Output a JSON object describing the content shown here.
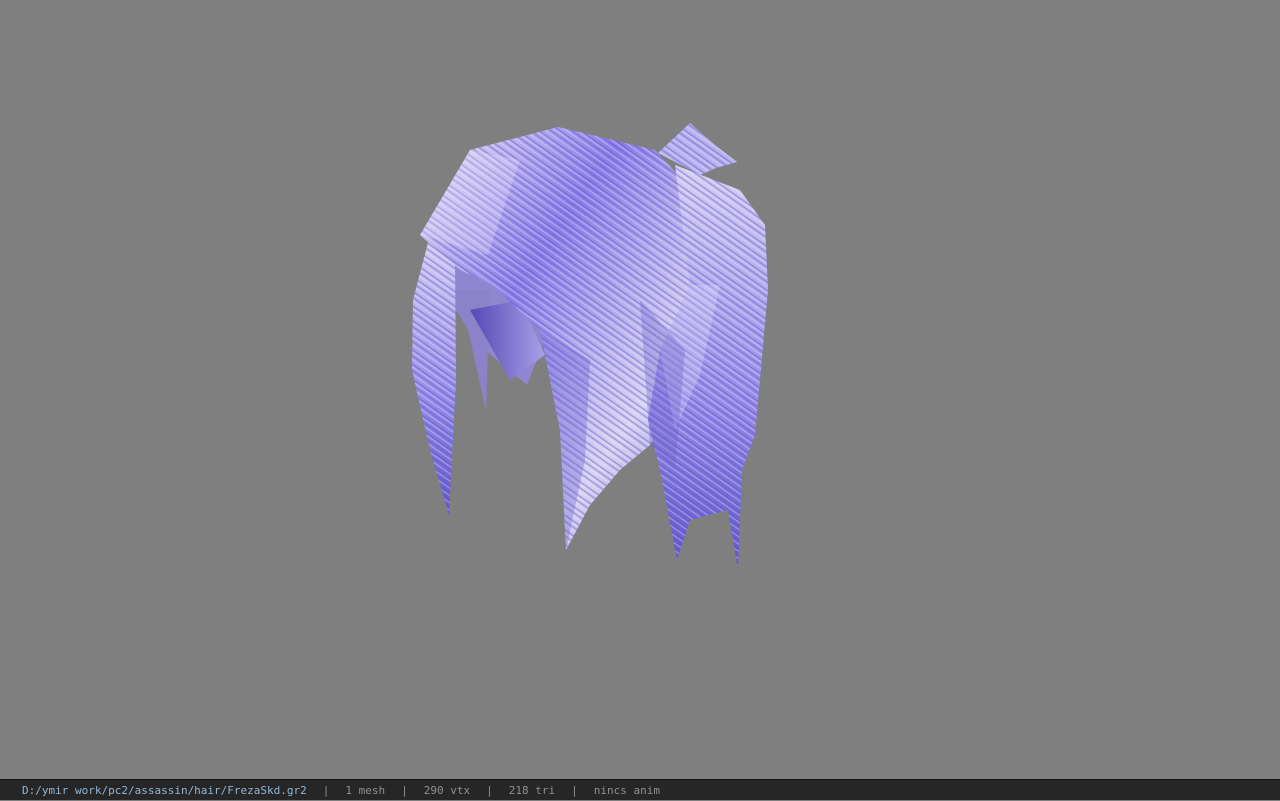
{
  "viewer": {
    "background_color": "#7f7f7f",
    "model_name": "hair-mesh"
  },
  "status_bar": {
    "file_path": "D:/ymir work/pc2/assassin/hair/FrezaSkd.gr2",
    "separator": "|",
    "meshes": "1 mesh",
    "vertices": "290 vtx",
    "triangles": "218 tri",
    "anim": "nincs anim",
    "path_color": "#8fb6d8",
    "text_color": "#8f8f8f"
  }
}
